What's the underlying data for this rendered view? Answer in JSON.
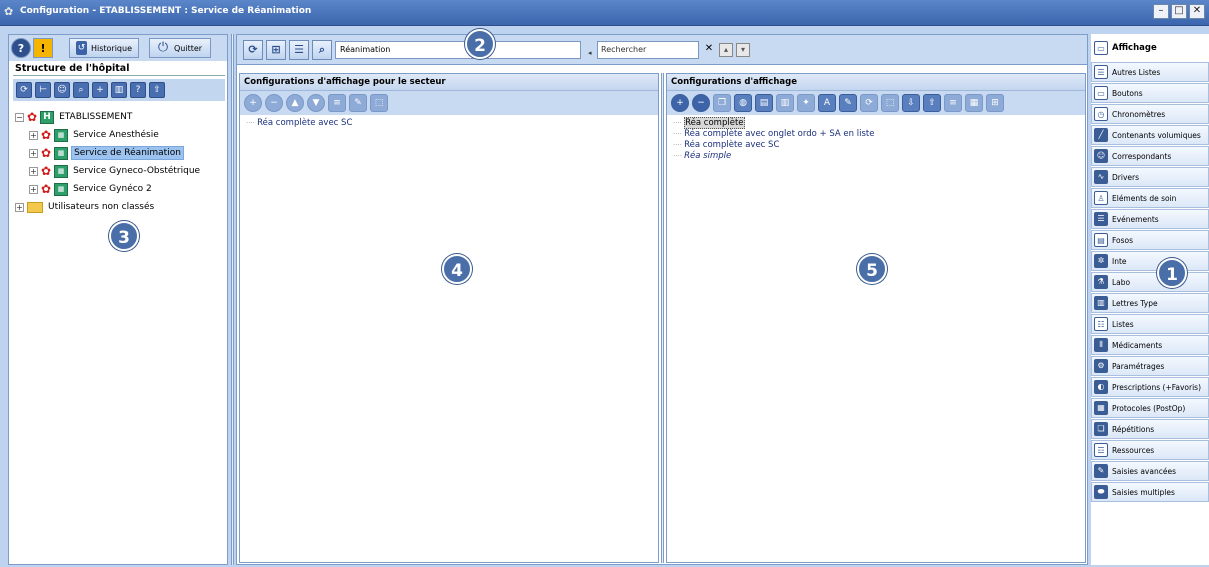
{
  "window": {
    "title": "Configuration - ETABLISSEMENT : Service de Réanimation",
    "controls": [
      "–",
      "□",
      "✕"
    ]
  },
  "left": {
    "historique_label": "Historique",
    "quitter_label": "Quitter",
    "group_title": "Structure de l'hôpital",
    "tree": {
      "root": "ETABLISSEMENT",
      "services": [
        "Service Anesthésie",
        "Service de Réanimation",
        "Service Gyneco-Obstétrique",
        "Service Gynéco 2"
      ],
      "selected_index": 1,
      "unclassified": "Utilisateurs non classés"
    }
  },
  "search": {
    "combo_value": "Réanimation",
    "search_placeholder": "Rechercher"
  },
  "pane_sector": {
    "title": "Configurations d'affichage pour le secteur",
    "items": [
      "Réa complète avec SC"
    ]
  },
  "pane_configs": {
    "title": "Configurations d'affichage",
    "items": [
      "Réa complète",
      "Réa complète avec onglet ordo + SA en liste",
      "Réa complète avec SC",
      "Réa simple"
    ]
  },
  "sidebar": {
    "items": [
      "Affichage",
      "Autres Listes",
      "Boutons",
      "Chronomètres",
      "Contenants volumiques",
      "Correspondants",
      "Drivers",
      "Eléments de soin",
      "Evénements",
      "Fosos",
      "Inte",
      "Labo",
      "Lettres Type",
      "Listes",
      "Médicaments",
      "Paramétrages",
      "Prescriptions (+Favoris)",
      "Protocoles (PostOp)",
      "Répétitions",
      "Ressources",
      "Saisies avancées",
      "Saisies multiples"
    ],
    "active_index": 0
  },
  "badges": [
    "1",
    "2",
    "3",
    "4",
    "5"
  ],
  "colors": {
    "titlebar": "#4a75bb",
    "panel_bg": "#bdd3ef",
    "badge": "#4a6fa8",
    "selection": "#9cc3ef"
  }
}
